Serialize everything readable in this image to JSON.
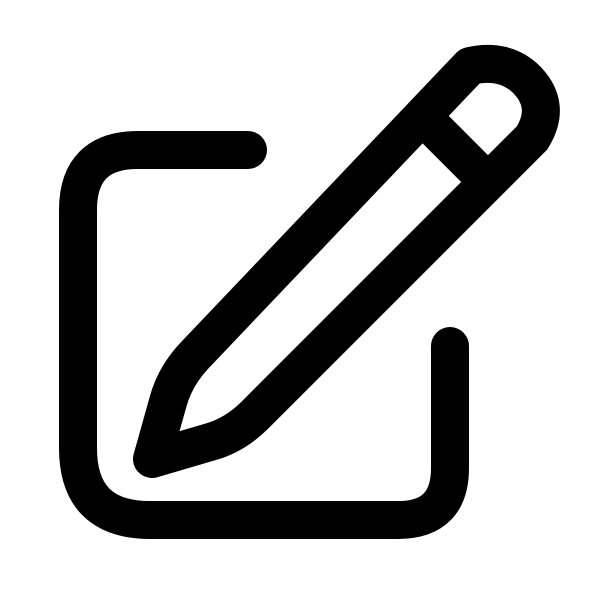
{
  "icon": {
    "name": "edit-icon",
    "stroke_color": "#000000",
    "background_color": "#ffffff"
  }
}
